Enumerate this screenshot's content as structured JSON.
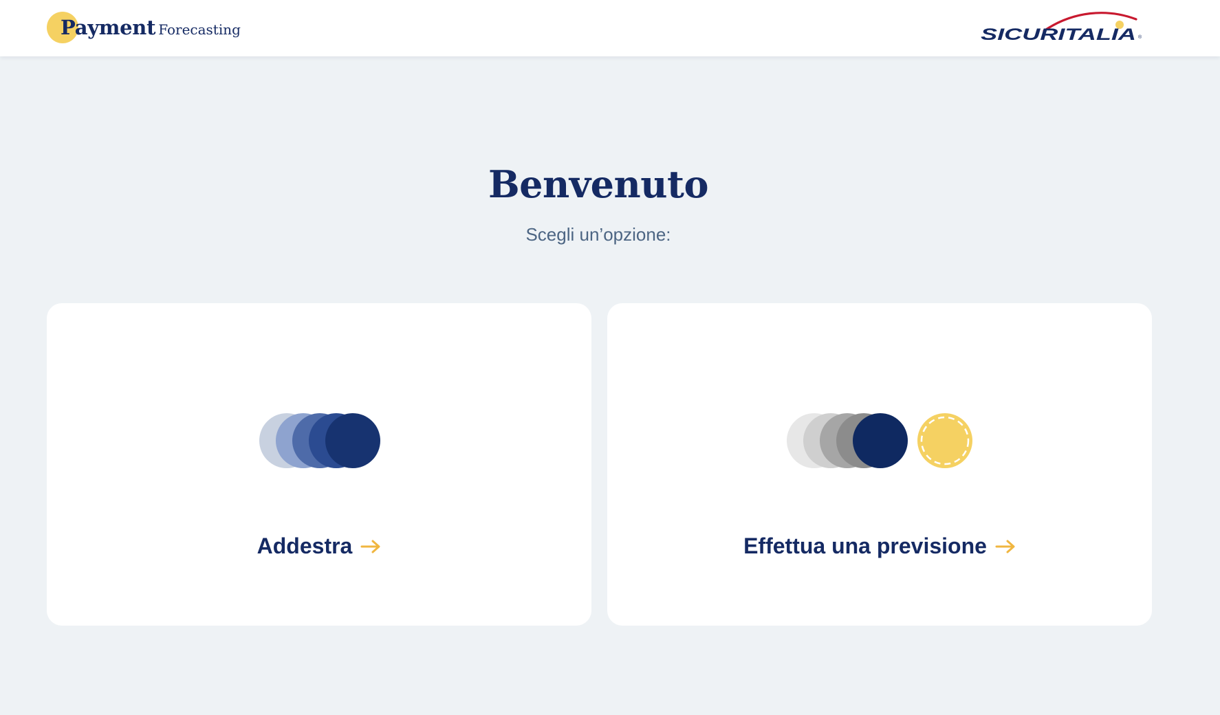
{
  "header": {
    "brand": {
      "name_strong": "Payment",
      "name_light": "Forecasting"
    },
    "partner_logo": {
      "text": "SICURITALIA"
    }
  },
  "main": {
    "title": "Benvenuto",
    "subtitle": "Scegli un’opzione:",
    "options": [
      {
        "label": "Addestra",
        "icon": "stacked-blue-circles-icon",
        "arrow": "arrow-right-icon"
      },
      {
        "label": "Effettua una previsione",
        "icon": "stacked-gray-circles-with-yellow-dot-icon",
        "arrow": "arrow-right-icon"
      }
    ]
  },
  "colors": {
    "navy": "#152a63",
    "accent_yellow": "#f5d162",
    "arrow_yellow": "#f0b640",
    "background": "#eef2f5",
    "subtitle": "#4c6583",
    "logo_red": "#c8192f"
  }
}
